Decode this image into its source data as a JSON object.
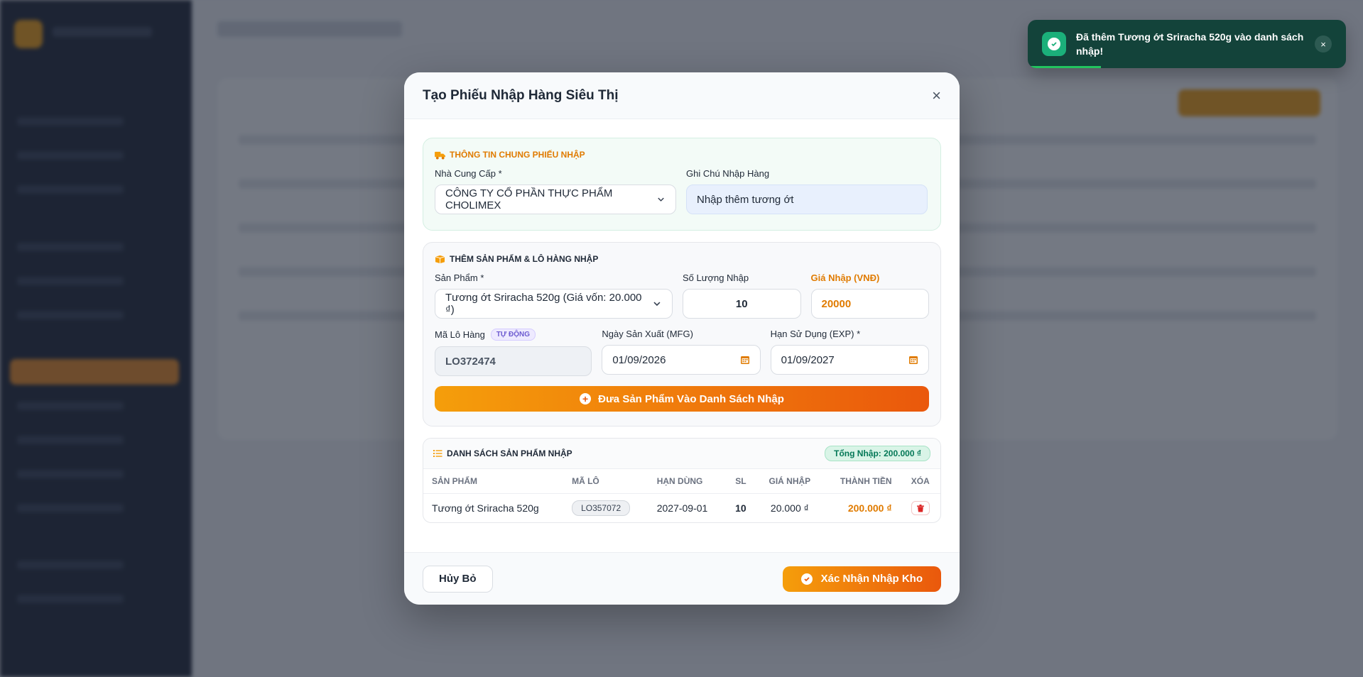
{
  "modal": {
    "title": "Tạo Phiếu Nhập Hàng Siêu Thị",
    "close_glyph": "×",
    "general": {
      "heading": "THÔNG TIN CHUNG PHIẾU NHẬP",
      "supplier_label": "Nhà Cung Cấp *",
      "supplier_value": "CÔNG TY CỔ PHẦN THỰC PHẨM CHOLIMEX",
      "note_label": "Ghi Chú Nhập Hàng",
      "note_value": "Nhập thêm tương ớt"
    },
    "add_product": {
      "heading": "THÊM SẢN PHẨM & LÔ HÀNG NHẬP",
      "product_label": "Sản Phẩm *",
      "product_value": "Tương ớt Sriracha 520g (Giá vốn: 20.000 ₫)",
      "quantity_label": "Số Lượng Nhập",
      "quantity_value": "10",
      "price_label": "Giá Nhập (VNĐ)",
      "price_value": "20000",
      "lot_label": "Mã Lô Hàng",
      "lot_badge": "TỰ ĐỘNG",
      "lot_value": "LO372474",
      "mfg_label": "Ngày Sản Xuất (MFG)",
      "mfg_value": "01/09/2026",
      "exp_label": "Hạn Sử Dụng (EXP) *",
      "exp_value": "01/09/2027",
      "add_button": "Đưa Sản Phẩm Vào Danh Sách Nhập"
    },
    "list": {
      "heading": "DANH SÁCH SẢN PHẨM NHẬP",
      "total": "Tổng Nhập: 200.000 ₫",
      "columns": [
        "SẢN PHẨM",
        "MÃ LÔ",
        "HẠN DÙNG",
        "SL",
        "GIÁ NHẬP",
        "THÀNH TIỀN",
        "XÓA"
      ],
      "rows": [
        {
          "product": "Tương ớt Sriracha 520g",
          "lot": "LO357072",
          "expiry": "2027-09-01",
          "qty": "10",
          "price": "20.000 ₫",
          "amount": "200.000 ₫"
        }
      ]
    },
    "footer": {
      "cancel": "Hủy Bỏ",
      "confirm": "Xác Nhận Nhập Kho"
    }
  },
  "toast": {
    "message": "Đã thêm Tương ớt Sriracha 520g vào danh sách nhập!",
    "close_glyph": "×",
    "progress": 0.23
  },
  "colors": {
    "accent": "#f59e0b",
    "accent_dark": "#ea580c",
    "success": "#1bb07a",
    "toast_bg": "#13433a"
  },
  "icons": {
    "section_general": "truck-icon",
    "section_add": "box-icon",
    "section_list": "list-icon",
    "calendar": "calendar-icon",
    "delete": "trash-icon"
  }
}
